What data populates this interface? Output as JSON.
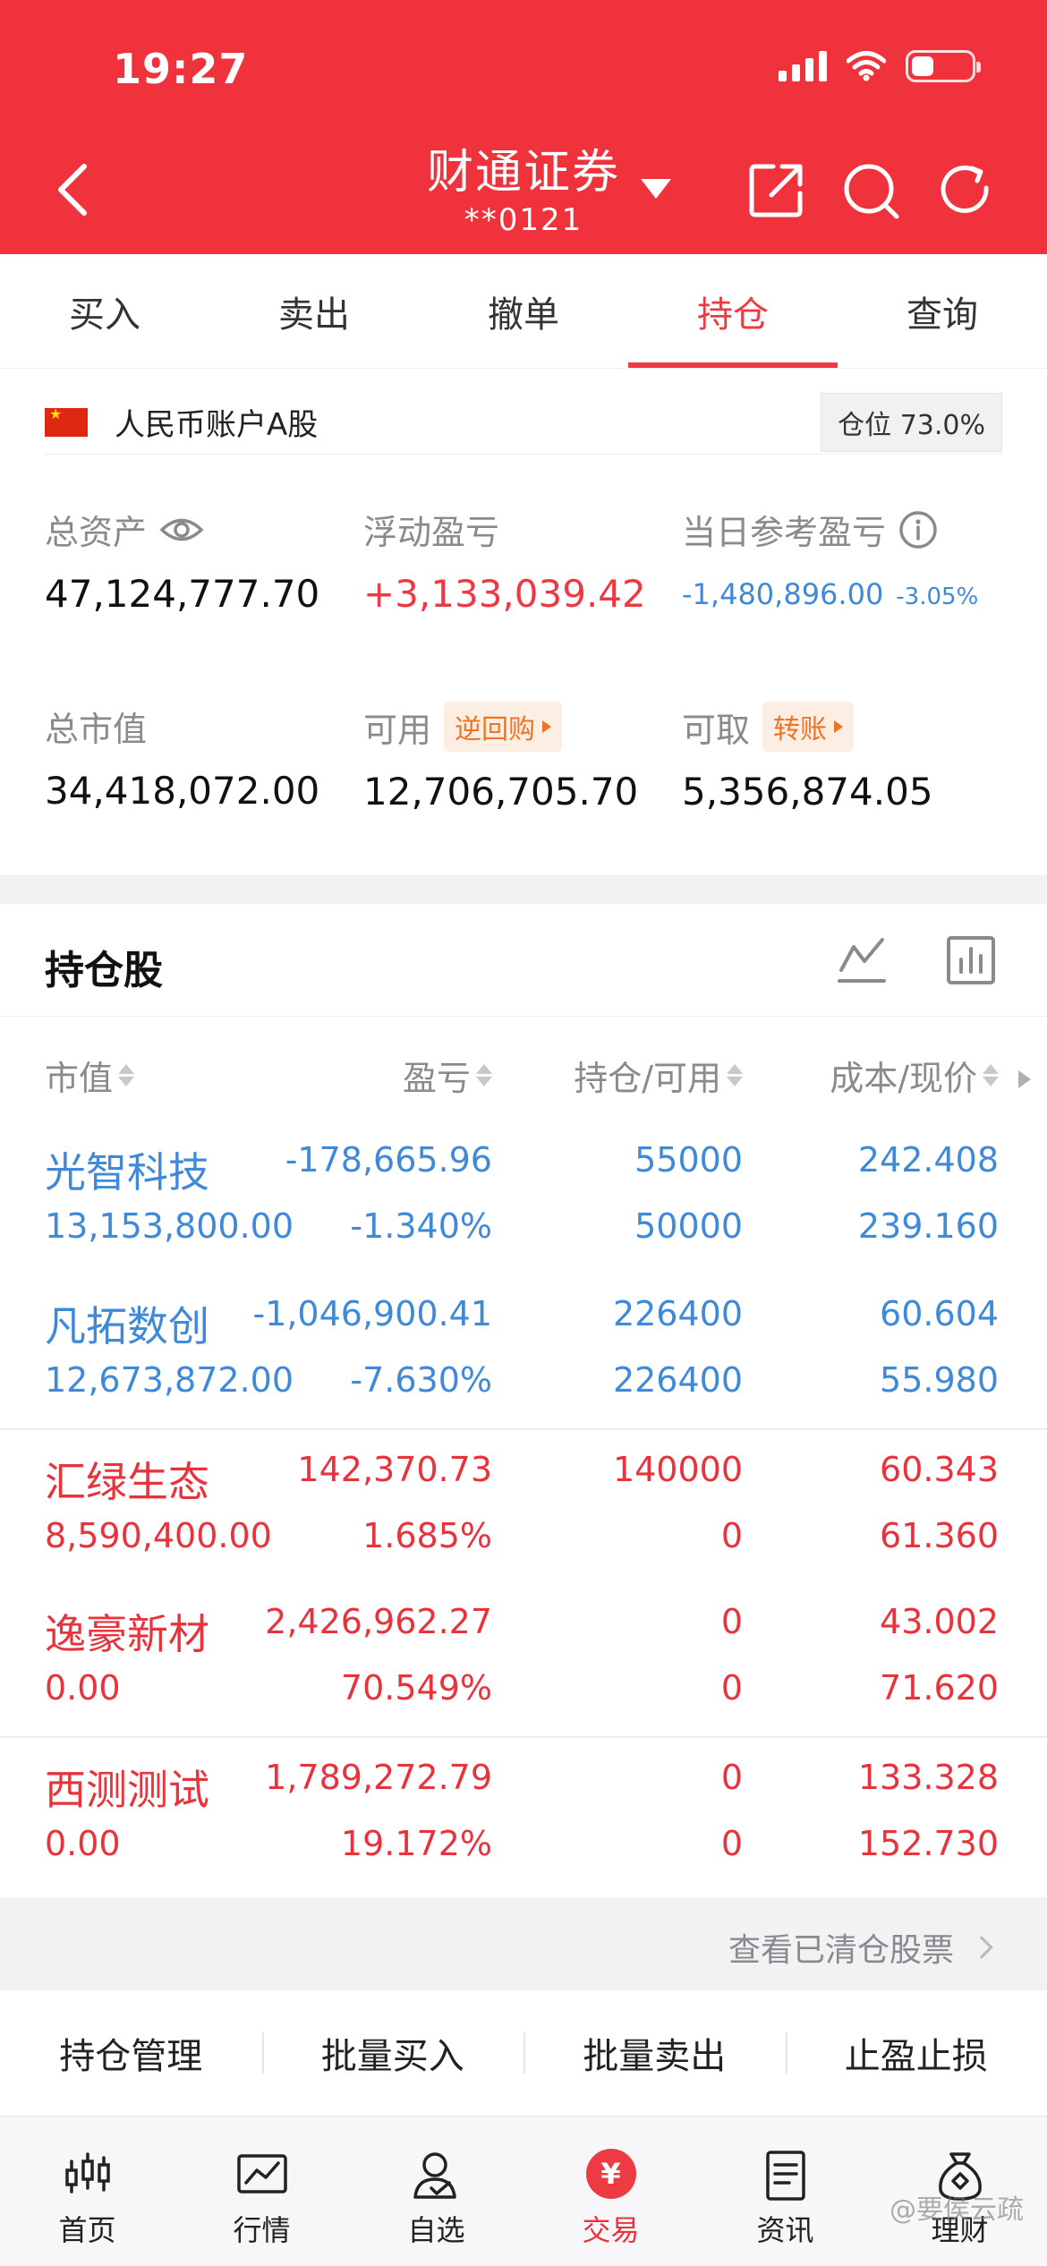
{
  "status_bar": {
    "time": "19:27"
  },
  "header": {
    "title": "财通证券",
    "account": "**0121"
  },
  "tabs": [
    {
      "label": "买入"
    },
    {
      "label": "卖出"
    },
    {
      "label": "撤单"
    },
    {
      "label": "持仓",
      "active": true
    },
    {
      "label": "查询"
    }
  ],
  "account": {
    "name": "人民币账户A股",
    "position_label": "仓位",
    "position_value": "73.0%"
  },
  "metrics": {
    "total_assets_label": "总资产",
    "total_assets": "47,124,777.70",
    "floating_pl_label": "浮动盈亏",
    "floating_pl": "+3,133,039.42",
    "daily_pl_label": "当日参考盈亏",
    "daily_pl": "-1,480,896.00",
    "daily_pl_pct": "-3.05%",
    "market_value_label": "总市值",
    "market_value": "34,418,072.00",
    "available_label": "可用",
    "available": "12,706,705.70",
    "reverse_repo": "逆回购",
    "withdrawable_label": "可取",
    "withdrawable": "5,356,874.05",
    "transfer": "转账"
  },
  "holdings": {
    "title": "持仓股",
    "columns": {
      "market_value": "市值",
      "pl": "盈亏",
      "qty": "持仓/可用",
      "cost": "成本/现价"
    },
    "rows": [
      {
        "name": "光智科技",
        "market_value": "13,153,800.00",
        "pl": "-178,665.96",
        "pl_pct": "-1.340%",
        "qty": "55000",
        "available": "50000",
        "cost": "242.408",
        "price": "239.160",
        "trend": "loss"
      },
      {
        "name": "凡拓数创",
        "market_value": "12,673,872.00",
        "pl": "-1,046,900.41",
        "pl_pct": "-7.630%",
        "qty": "226400",
        "available": "226400",
        "cost": "60.604",
        "price": "55.980",
        "trend": "loss"
      },
      {
        "name": "汇绿生态",
        "market_value": "8,590,400.00",
        "pl": "142,370.73",
        "pl_pct": "1.685%",
        "qty": "140000",
        "available": "0",
        "cost": "60.343",
        "price": "61.360",
        "trend": "gain"
      },
      {
        "name": "逸豪新材",
        "market_value": "0.00",
        "pl": "2,426,962.27",
        "pl_pct": "70.549%",
        "qty": "0",
        "available": "0",
        "cost": "43.002",
        "price": "71.620",
        "trend": "gain"
      },
      {
        "name": "西测测试",
        "market_value": "0.00",
        "pl": "1,789,272.79",
        "pl_pct": "19.172%",
        "qty": "0",
        "available": "0",
        "cost": "133.328",
        "price": "152.730",
        "trend": "gain"
      }
    ],
    "cleared_link": "查看已清仓股票"
  },
  "actions": [
    {
      "label": "持仓管理"
    },
    {
      "label": "批量买入"
    },
    {
      "label": "批量卖出"
    },
    {
      "label": "止盈止损"
    }
  ],
  "bottom_nav": [
    {
      "label": "首页",
      "icon": "candlestick-icon"
    },
    {
      "label": "行情",
      "icon": "chart-icon"
    },
    {
      "label": "自选",
      "icon": "user-check-icon"
    },
    {
      "label": "交易",
      "icon": "yen-icon",
      "active": true
    },
    {
      "label": "资讯",
      "icon": "document-icon"
    },
    {
      "label": "理财",
      "icon": "money-bag-icon"
    }
  ],
  "watermark": "@要侯云疏",
  "colors": {
    "brand_red": "#f0323c",
    "loss_blue": "#3f8ad8",
    "gain_red": "#e8323c",
    "chip_orange": "#f07224"
  }
}
